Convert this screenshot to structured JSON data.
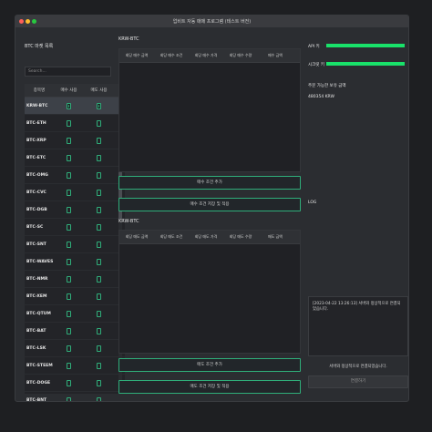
{
  "window": {
    "title": "업비트 자동 매매 프로그램 (테스트 버전)"
  },
  "left": {
    "title": "BTC 마켓 목록",
    "search_placeholder": "Search...",
    "headers": [
      "종목명",
      "매수 사용",
      "매도 사용"
    ],
    "rows": [
      {
        "name": "KRW-BTC",
        "buy": true,
        "sell": true
      },
      {
        "name": "BTC-ETH",
        "buy": false,
        "sell": false
      },
      {
        "name": "BTC-XRP",
        "buy": false,
        "sell": false
      },
      {
        "name": "BTC-ETC",
        "buy": false,
        "sell": false
      },
      {
        "name": "BTC-OMG",
        "buy": false,
        "sell": false
      },
      {
        "name": "BTC-CVC",
        "buy": false,
        "sell": false
      },
      {
        "name": "BTC-DGB",
        "buy": false,
        "sell": false
      },
      {
        "name": "BTC-SC",
        "buy": false,
        "sell": false
      },
      {
        "name": "BTC-SNT",
        "buy": false,
        "sell": false
      },
      {
        "name": "BTC-WAVES",
        "buy": false,
        "sell": false
      },
      {
        "name": "BTC-NMR",
        "buy": false,
        "sell": false
      },
      {
        "name": "BTC-XEM",
        "buy": false,
        "sell": false
      },
      {
        "name": "BTC-QTUM",
        "buy": false,
        "sell": false
      },
      {
        "name": "BTC-BAT",
        "buy": false,
        "sell": false
      },
      {
        "name": "BTC-LSK",
        "buy": false,
        "sell": false
      },
      {
        "name": "BTC-STEEM",
        "buy": false,
        "sell": false
      },
      {
        "name": "BTC-DOGE",
        "buy": false,
        "sell": false
      },
      {
        "name": "BTC-BNT",
        "buy": false,
        "sell": false
      }
    ]
  },
  "buy": {
    "market": "KRW-BTC",
    "headers": [
      "회당 매수 금액",
      "회당 매수 조건",
      "회당 매수 가격",
      "회당 매수 수량",
      "매수 금액",
      "매"
    ],
    "add_button": "매수 조건 추가",
    "save_button": "매수 조건 저장 및 적용"
  },
  "sell": {
    "market": "KRW-BTC",
    "headers": [
      "회당 매도 금액",
      "회당 매도 조건",
      "회당 매도 가격",
      "회당 매도 수량",
      "매도 금액",
      "매"
    ],
    "add_button": "매도 조건 추가",
    "save_button": "매도 조건 저장 및 적용"
  },
  "right": {
    "api_label": "API 키",
    "secret_label": "시크릿 키",
    "balance_label": "주문 가능한 보유 금액",
    "balance_value": "480354 KRW",
    "log_label": "LOG",
    "log_text": "[2023-04-22 13:26:13] 서버와 정상적으로 연결되었습니다.",
    "status_text": "서버와 정상적으로 연결되었습니다.",
    "connect_button": "연결하기",
    "accent": "#19e26a"
  }
}
